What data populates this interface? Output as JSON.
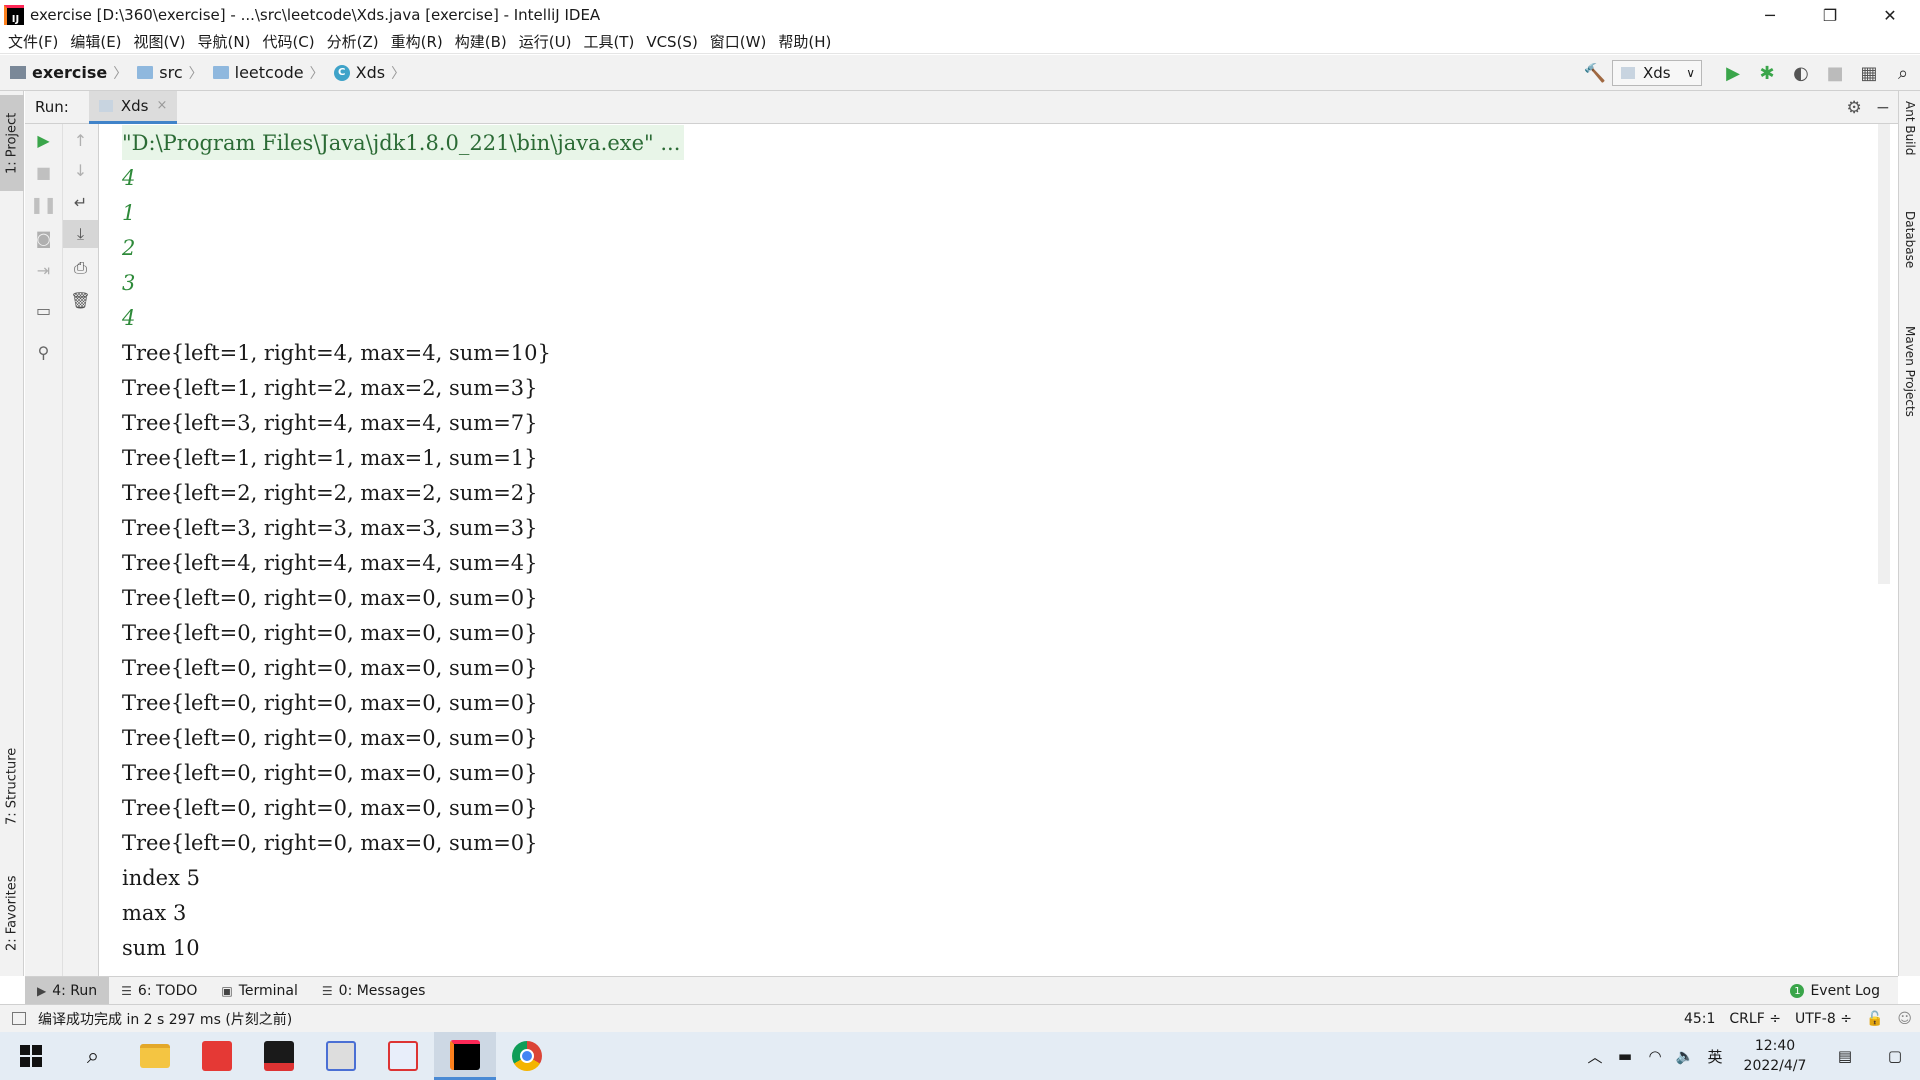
{
  "window": {
    "title": "exercise [D:\\360\\exercise] - ...\\src\\leetcode\\Xds.java [exercise] - IntelliJ IDEA",
    "app_icon_label": "IJ",
    "minimize": "─",
    "maximize": "❐",
    "close": "✕"
  },
  "menu": [
    "文件(F)",
    "编辑(E)",
    "视图(V)",
    "导航(N)",
    "代码(C)",
    "分析(Z)",
    "重构(R)",
    "构建(B)",
    "运行(U)",
    "工具(T)",
    "VCS(S)",
    "窗口(W)",
    "帮助(H)"
  ],
  "breadcrumb": {
    "project": "exercise",
    "src": "src",
    "package": "leetcode",
    "class": "Xds",
    "class_icon": "C"
  },
  "run_config": {
    "name": "Xds",
    "chevron": "∨"
  },
  "left_tabs": {
    "project": "1: Project",
    "structure": "7: Structure",
    "favorites": "2: Favorites"
  },
  "right_tabs": {
    "ant": "Ant Build",
    "database": "Database",
    "maven": "Maven Projects"
  },
  "run_panel": {
    "label": "Run:",
    "tab": "Xds",
    "tab_close": "×"
  },
  "console": {
    "command": "\"D:\\Program Files\\Java\\jdk1.8.0_221\\bin\\java.exe\" ...",
    "inputs": [
      "4",
      "1",
      "2",
      "3",
      "4"
    ],
    "outputs": [
      "Tree{left=1, right=4, max=4, sum=10}",
      "Tree{left=1, right=2, max=2, sum=3}",
      "Tree{left=3, right=4, max=4, sum=7}",
      "Tree{left=1, right=1, max=1, sum=1}",
      "Tree{left=2, right=2, max=2, sum=2}",
      "Tree{left=3, right=3, max=3, sum=3}",
      "Tree{left=4, right=4, max=4, sum=4}",
      "Tree{left=0, right=0, max=0, sum=0}",
      "Tree{left=0, right=0, max=0, sum=0}",
      "Tree{left=0, right=0, max=0, sum=0}",
      "Tree{left=0, right=0, max=0, sum=0}",
      "Tree{left=0, right=0, max=0, sum=0}",
      "Tree{left=0, right=0, max=0, sum=0}",
      "Tree{left=0, right=0, max=0, sum=0}",
      "Tree{left=0, right=0, max=0, sum=0}",
      "index 5",
      "max 3",
      "sum 10"
    ]
  },
  "bottom_tabs": [
    {
      "icon": "▶",
      "label": "4: Run"
    },
    {
      "icon": "☰",
      "label": "6: TODO"
    },
    {
      "icon": "▣",
      "label": "Terminal"
    },
    {
      "icon": "☰",
      "label": "0: Messages"
    }
  ],
  "event_log": {
    "label": "Event Log",
    "count": "1"
  },
  "status": {
    "message": "编译成功完成 in 2 s 297 ms (片刻之前)",
    "position": "45:1",
    "line_sep": "CRLF ÷",
    "encoding": "UTF-8 ÷"
  },
  "taskbar": {
    "ime": "英",
    "time": "12:40",
    "date": "2022/4/7"
  },
  "colors": {
    "console_input": "#2e8a3a",
    "console_cmd_bg": "#e8f5e8",
    "run_green": "#3aa54a",
    "tab_underline": "#4083c9"
  }
}
